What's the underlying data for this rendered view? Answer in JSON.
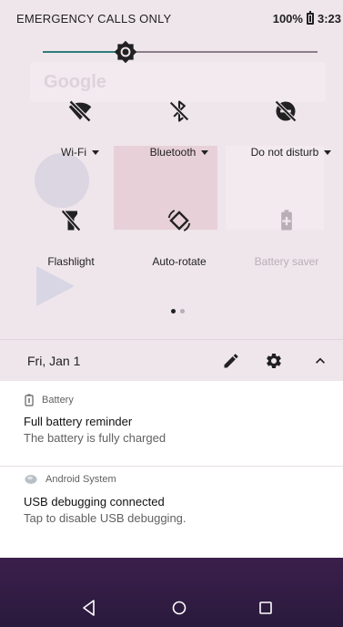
{
  "status_bar": {
    "carrier": "EMERGENCY CALLS ONLY",
    "battery_percent": "100%",
    "time": "3:23"
  },
  "brightness": {
    "level": 0.3
  },
  "quick_settings": {
    "tiles": [
      {
        "label": "Wi-Fi",
        "icon": "wifi-off-icon",
        "has_dropdown": true,
        "active": true
      },
      {
        "label": "Bluetooth",
        "icon": "bluetooth-off-icon",
        "has_dropdown": true,
        "active": true
      },
      {
        "label": "Do not disturb",
        "icon": "do-not-disturb-off-icon",
        "has_dropdown": true,
        "active": true
      },
      {
        "label": "Flashlight",
        "icon": "flashlight-off-icon",
        "has_dropdown": false,
        "active": true
      },
      {
        "label": "Auto-rotate",
        "icon": "auto-rotate-icon",
        "has_dropdown": false,
        "active": true
      },
      {
        "label": "Battery saver",
        "icon": "battery-saver-icon",
        "has_dropdown": false,
        "active": false
      }
    ],
    "page_indicator": {
      "pages": 2,
      "current": 1
    }
  },
  "date_row": {
    "date": "Fri, Jan 1"
  },
  "notifications": [
    {
      "app": "Battery",
      "title": "Full battery reminder",
      "body": "The battery is fully charged"
    },
    {
      "app": "Android System",
      "title": "USB debugging connected",
      "body": "Tap to disable USB debugging."
    }
  ],
  "colors": {
    "shade_background": "#efe6ec",
    "accent": "#2e7d78",
    "nav_bar": "#2f1b40"
  }
}
